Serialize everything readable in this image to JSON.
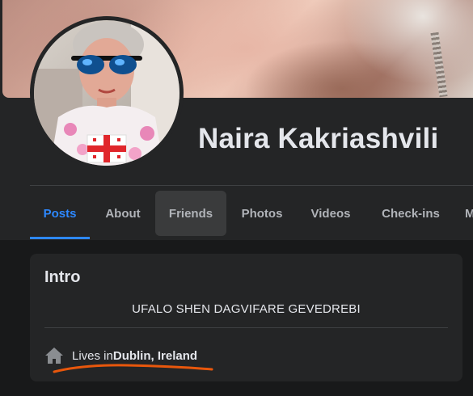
{
  "profile": {
    "name": "Naira Kakriashvili"
  },
  "tabs": [
    {
      "label": "Posts",
      "active": true
    },
    {
      "label": "About"
    },
    {
      "label": "Friends",
      "hover": true
    },
    {
      "label": "Photos"
    },
    {
      "label": "Videos"
    },
    {
      "label": "Check-ins"
    },
    {
      "label": "M"
    }
  ],
  "intro": {
    "title": "Intro",
    "bio": "UFALO SHEN DAGVIFARE GEVEDREBI",
    "lives_prefix": "Lives in ",
    "lives_place": "Dublin, Ireland",
    "icon": "home-icon"
  },
  "colors": {
    "background": "#18191a",
    "card": "#242526",
    "accent": "#2d88ff",
    "annotation": "#e8570c"
  }
}
